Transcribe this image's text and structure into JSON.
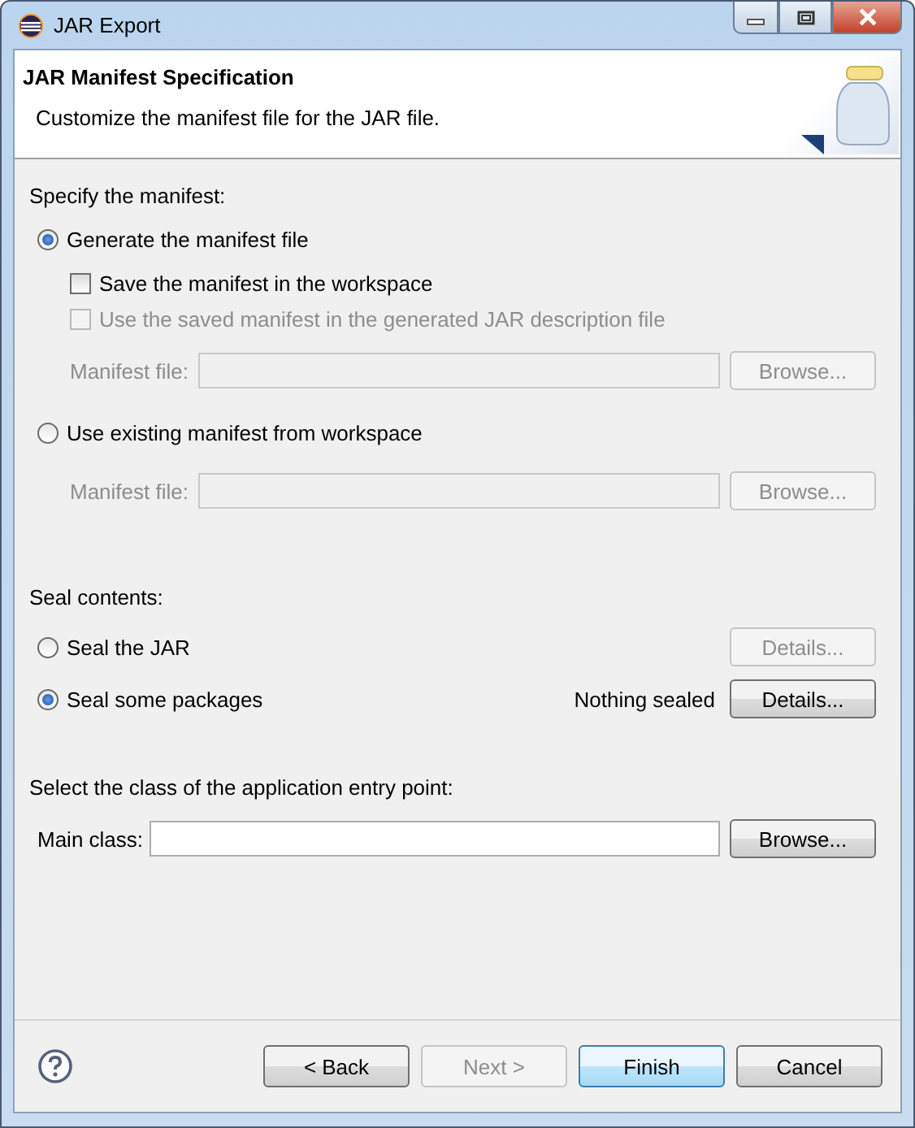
{
  "window": {
    "title": "JAR Export"
  },
  "header": {
    "title": "JAR Manifest Specification",
    "description": "Customize the manifest file for the JAR file."
  },
  "manifest": {
    "label": "Specify the manifest:",
    "generate": {
      "label": "Generate the manifest file",
      "selected": true
    },
    "save_checkbox": {
      "label": "Save the manifest in the workspace",
      "checked": false,
      "disabled": false
    },
    "use_saved_checkbox": {
      "label": "Use the saved manifest in the generated JAR description file",
      "checked": false,
      "disabled": true
    },
    "generate_file": {
      "label": "Manifest file:",
      "disabled": true,
      "browse": {
        "label": "Browse...",
        "disabled": true
      }
    },
    "existing": {
      "label": "Use existing manifest from workspace",
      "selected": false
    },
    "existing_file": {
      "label": "Manifest file:",
      "disabled": true,
      "browse": {
        "label": "Browse...",
        "disabled": true
      }
    }
  },
  "seal": {
    "label": "Seal contents:",
    "options": [
      {
        "label": "Seal the JAR",
        "selected": false,
        "button": {
          "label": "Details...",
          "disabled": true
        }
      },
      {
        "label": "Seal some packages",
        "selected": true,
        "status": "Nothing sealed",
        "button": {
          "label": "Details...",
          "disabled": false
        }
      }
    ]
  },
  "entry": {
    "label": "Select the class of the application entry point:",
    "field_label": "Main class:",
    "browse": {
      "label": "Browse...",
      "disabled": false
    }
  },
  "buttons": [
    {
      "label": "< Back",
      "disabled": false,
      "default": false
    },
    {
      "label": "Next >",
      "disabled": true,
      "default": false
    },
    {
      "label": "Finish",
      "disabled": false,
      "default": true
    },
    {
      "label": "Cancel",
      "disabled": false,
      "default": false
    }
  ]
}
